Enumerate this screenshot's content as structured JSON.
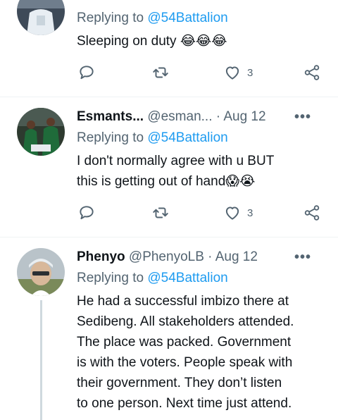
{
  "tweets": [
    {
      "replying_prefix": "Replying to",
      "replying_to": "@54Battalion",
      "text": "Sleeping on duty",
      "emoji": "😂😂😂",
      "like_count": "3"
    },
    {
      "name": "Esmants...",
      "handle": "@esman...",
      "separator": "·",
      "date": "Aug 12",
      "replying_prefix": "Replying to",
      "replying_to": "@54Battalion",
      "text_line1": "I don't normally agree with u BUT",
      "text_line2": "this is getting out of hand",
      "emoji": "😱😭",
      "like_count": "3"
    },
    {
      "name": "Phenyo",
      "handle": "@PhenyoLB",
      "separator": "·",
      "date": "Aug 12",
      "replying_prefix": "Replying to",
      "replying_to": "@54Battalion",
      "text_lines": [
        "He had a successful imbizo there at",
        "Sedibeng. All stakeholders attended.",
        "The place was packed. Government",
        "is with the voters. People speak with",
        "their government. They don’t listen",
        "to one person. Next time just attend."
      ]
    }
  ],
  "more_label": "•••",
  "colors": {
    "accent": "#1d9bf0",
    "secondary_text": "#536471",
    "divider": "#eff3f4"
  }
}
